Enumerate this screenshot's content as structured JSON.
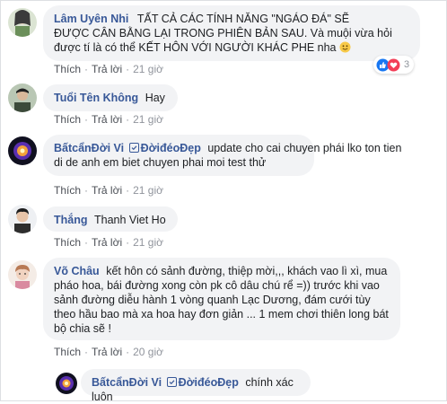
{
  "colors": {
    "name_link": "#385898",
    "bubble_bg": "#f2f3f5",
    "meta_text": "#90949c",
    "like_blue": "#1877f2",
    "love_red": "#f33e58"
  },
  "comments": [
    {
      "author": "Lâm Uyên Nhi",
      "text": "TẤT CẢ CÁC TÍNH NĂNG \"NGÁO ĐÁ\" SẼ ĐƯỢC CÂN BẰNG LẠI TRONG PHIÊN BẢN SAU. Và muội vừa hỏi được tí là có thể KẾT HÔN VỚI NGƯỜI KHÁC PHE nha",
      "emoji": "smiling-face",
      "like": "Thích",
      "reply": "Trả lời",
      "time": "21 giờ",
      "reaction_icons": [
        "like-icon",
        "love-icon"
      ],
      "reaction_count": "3"
    },
    {
      "author": "Tuổi Tên Không",
      "text": "Hay",
      "like": "Thích",
      "reply": "Trả lời",
      "time": "21 giờ"
    },
    {
      "author_parts": [
        "BấtcẩnĐời Vi ",
        "ĐờiđéoĐẹp"
      ],
      "text": "update cho cai chuyen phái lko ton tien di de anh em biet chuyen phai moi test thử",
      "like": "Thích",
      "reply": "Trả lời",
      "time": "21 giờ"
    },
    {
      "author": "Thắng",
      "text": "Thanh Viet Ho",
      "like": "Thích",
      "reply": "Trả lời",
      "time": "21 giờ"
    },
    {
      "author": "Võ Châu",
      "lines": [
        "kết hôn có sảnh đường, thiệp mời,,, khách vao lì xì, mua",
        "pháo hoa, bái đường xong còn pk cô dâu chú rể =)) trước khi vao",
        "sảnh đường diễu hành 1 vòng quanh Lạc Dương, đám cưới tùy",
        "theo hầu bao mà xa hoa hay đơn giản ... 1 mem chơi thiên long bát",
        "bộ chia sẽ !"
      ],
      "like": "Thích",
      "reply": "Trả lời",
      "time": "20 giờ"
    },
    {
      "author_parts": [
        "BấtcẩnĐời Vi ",
        "ĐờiđéoĐẹp"
      ],
      "text": "chính xác luôn"
    }
  ],
  "lines_c1": [
    "TẤT CẢ CÁC TÍNH NĂNG \"NGÁO ĐÁ\" SẼ",
    "ĐƯỢC CÂN BẰNG LẠI TRONG PHIÊN BẢN SAU. Và muội vừa hỏi",
    "được tí là có thể KẾT HÔN VỚI NGƯỜI KHÁC PHE nha"
  ],
  "lines_c3": [
    "update cho cai chuyen phái lko ton tien",
    "di de anh em biet chuyen phai moi test thử"
  ]
}
